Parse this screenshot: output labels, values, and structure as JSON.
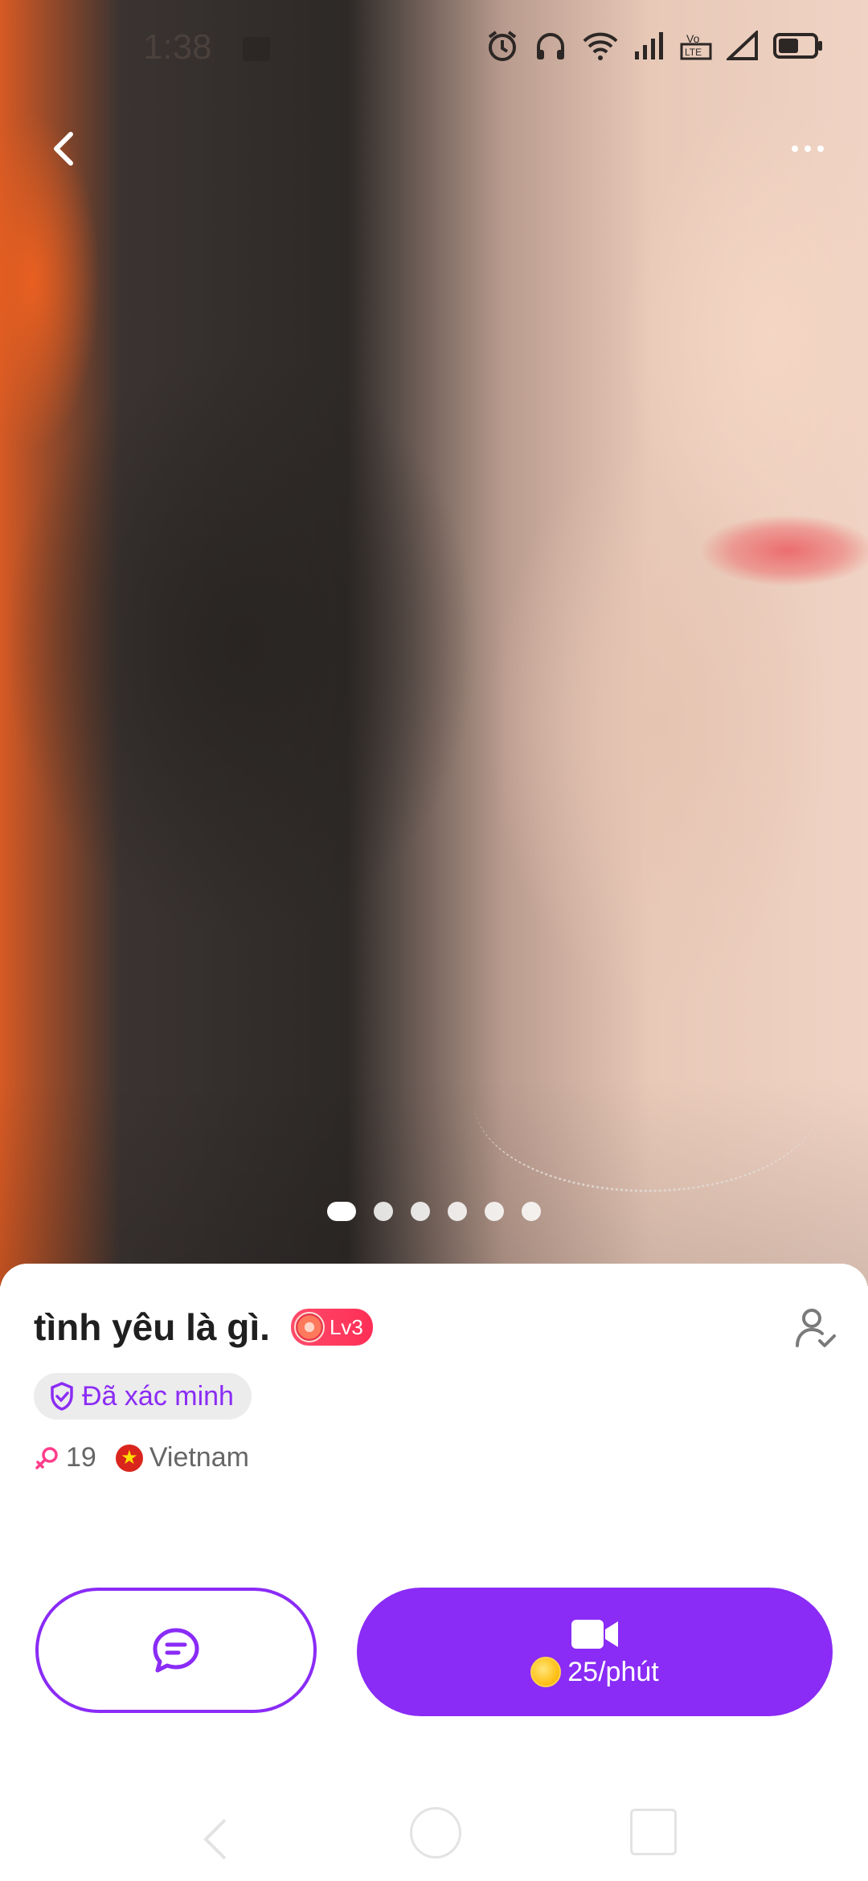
{
  "status_bar": {
    "time": "1:38",
    "icons": [
      "image-icon",
      "alarm-icon",
      "headphones-icon",
      "wifi-icon",
      "signal-icon",
      "volte-icon",
      "signal-empty-icon",
      "battery-icon"
    ],
    "volte_label": "Vo LTE"
  },
  "top_nav": {
    "back_icon": "chevron-left-icon",
    "more_icon": "more-dots-icon"
  },
  "photo_pager": {
    "count": 6,
    "active_index": 0
  },
  "profile": {
    "name": "tình yêu là gì.",
    "level": "Lv3",
    "verified_label": "Đã xác minh",
    "age": "19",
    "country": "Vietnam"
  },
  "actions": {
    "chat_icon": "chat-bubble-icon",
    "call_icon": "video-camera-icon",
    "price": "25/phút"
  },
  "colors": {
    "accent": "#8a2bf6",
    "level_badge": "#ff2e56",
    "gender": "#ff3d8b"
  }
}
